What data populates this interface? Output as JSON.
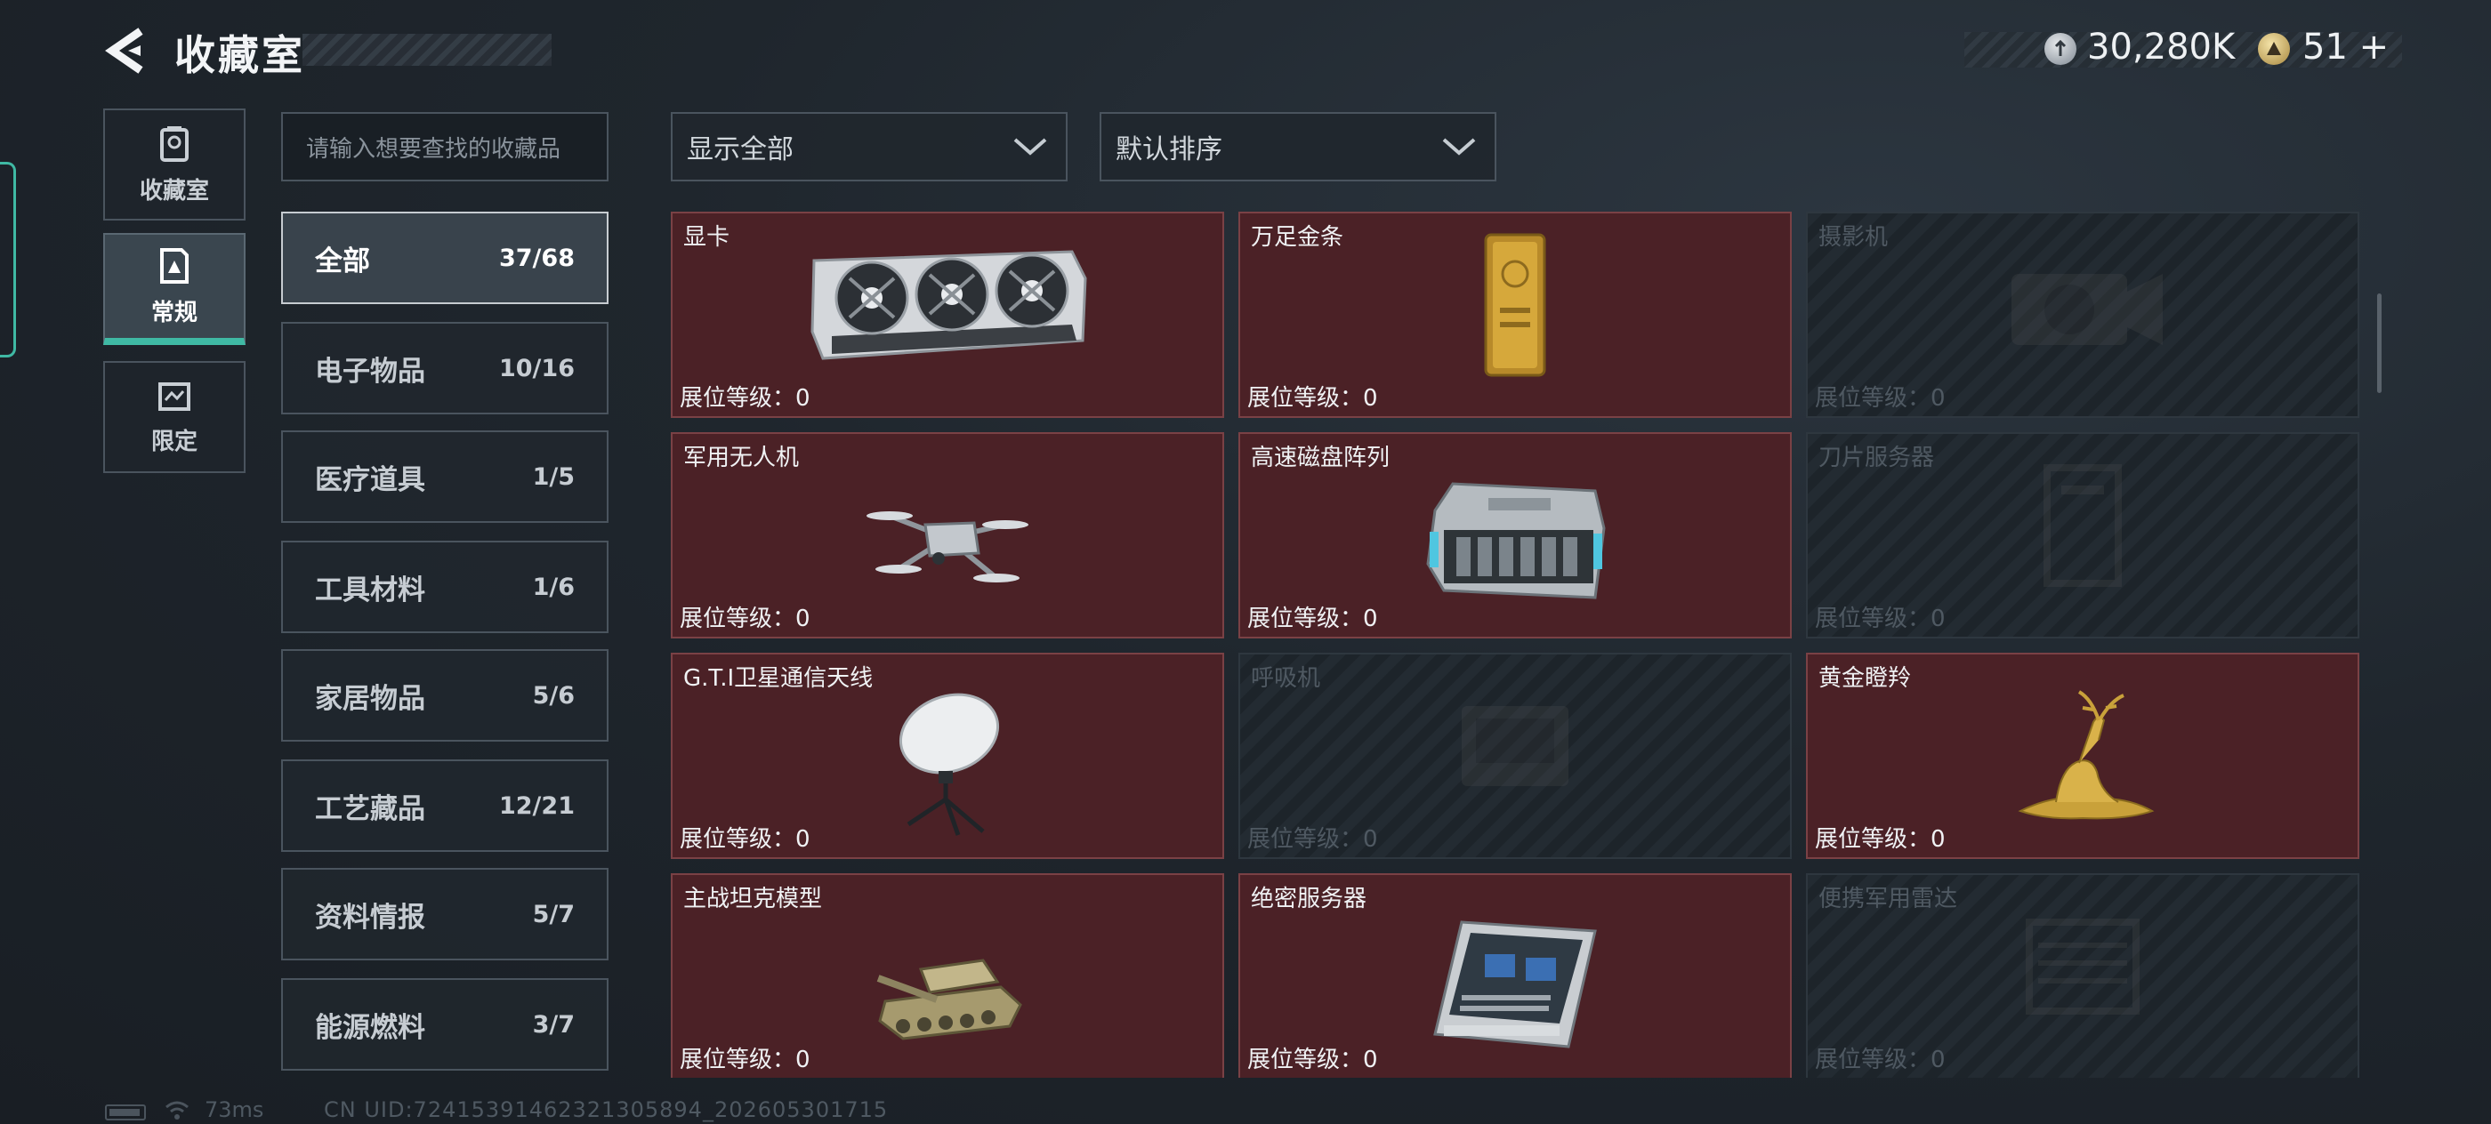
{
  "header": {
    "title": "收藏室",
    "money": "30,280K",
    "tickets": "51",
    "add_symbol": "+"
  },
  "nav": [
    {
      "label": "收藏室",
      "icon": "vault-icon"
    },
    {
      "label": "常规",
      "icon": "collection-icon",
      "active": true
    },
    {
      "label": "限定",
      "icon": "limited-icon"
    }
  ],
  "search": {
    "placeholder": "请输入想要查找的收藏品"
  },
  "filters": {
    "display": "显示全部",
    "sort": "默认排序"
  },
  "categories": [
    {
      "name": "全部",
      "count": "37/68",
      "active": true
    },
    {
      "name": "电子物品",
      "count": "10/16"
    },
    {
      "name": "医疗道具",
      "count": "1/5"
    },
    {
      "name": "工具材料",
      "count": "1/6"
    },
    {
      "name": "家居物品",
      "count": "5/6"
    },
    {
      "name": "工艺藏品",
      "count": "12/21"
    },
    {
      "name": "资料情报",
      "count": "5/7"
    },
    {
      "name": "能源燃料",
      "count": "3/7"
    }
  ],
  "items": [
    {
      "name": "显卡",
      "level": "展位等级：0",
      "owned": true,
      "icon": "graphics-card-icon"
    },
    {
      "name": "万足金条",
      "level": "展位等级：0",
      "owned": true,
      "icon": "gold-bar-icon"
    },
    {
      "name": "摄影机",
      "level": "展位等级：0",
      "owned": false,
      "icon": "camera-icon"
    },
    {
      "name": "军用无人机",
      "level": "展位等级：0",
      "owned": true,
      "icon": "drone-icon"
    },
    {
      "name": "高速磁盘阵列",
      "level": "展位等级：0",
      "owned": true,
      "icon": "disk-array-icon"
    },
    {
      "name": "刀片服务器",
      "level": "展位等级：0",
      "owned": false,
      "icon": "blade-server-icon"
    },
    {
      "name": "G.T.I卫星通信天线",
      "level": "展位等级：0",
      "owned": true,
      "icon": "satellite-antenna-icon"
    },
    {
      "name": "呼吸机",
      "level": "展位等级：0",
      "owned": false,
      "icon": "ventilator-icon"
    },
    {
      "name": "黄金瞪羚",
      "level": "展位等级：0",
      "owned": true,
      "icon": "golden-gazelle-icon"
    },
    {
      "name": "主战坦克模型",
      "level": "展位等级：0",
      "owned": true,
      "icon": "tank-model-icon"
    },
    {
      "name": "绝密服务器",
      "level": "展位等级：0",
      "owned": true,
      "icon": "server-icon"
    },
    {
      "name": "便携军用雷达",
      "level": "展位等级：0",
      "owned": false,
      "icon": "radar-icon"
    }
  ],
  "status": {
    "ping": "73ms",
    "uid": "CN UID:72415391462321305894_202605301715"
  },
  "colors": {
    "accent": "#3fb9a4",
    "owned_card": "#4b2126",
    "owned_border": "#7a4145",
    "locked_card": "#232b32"
  }
}
